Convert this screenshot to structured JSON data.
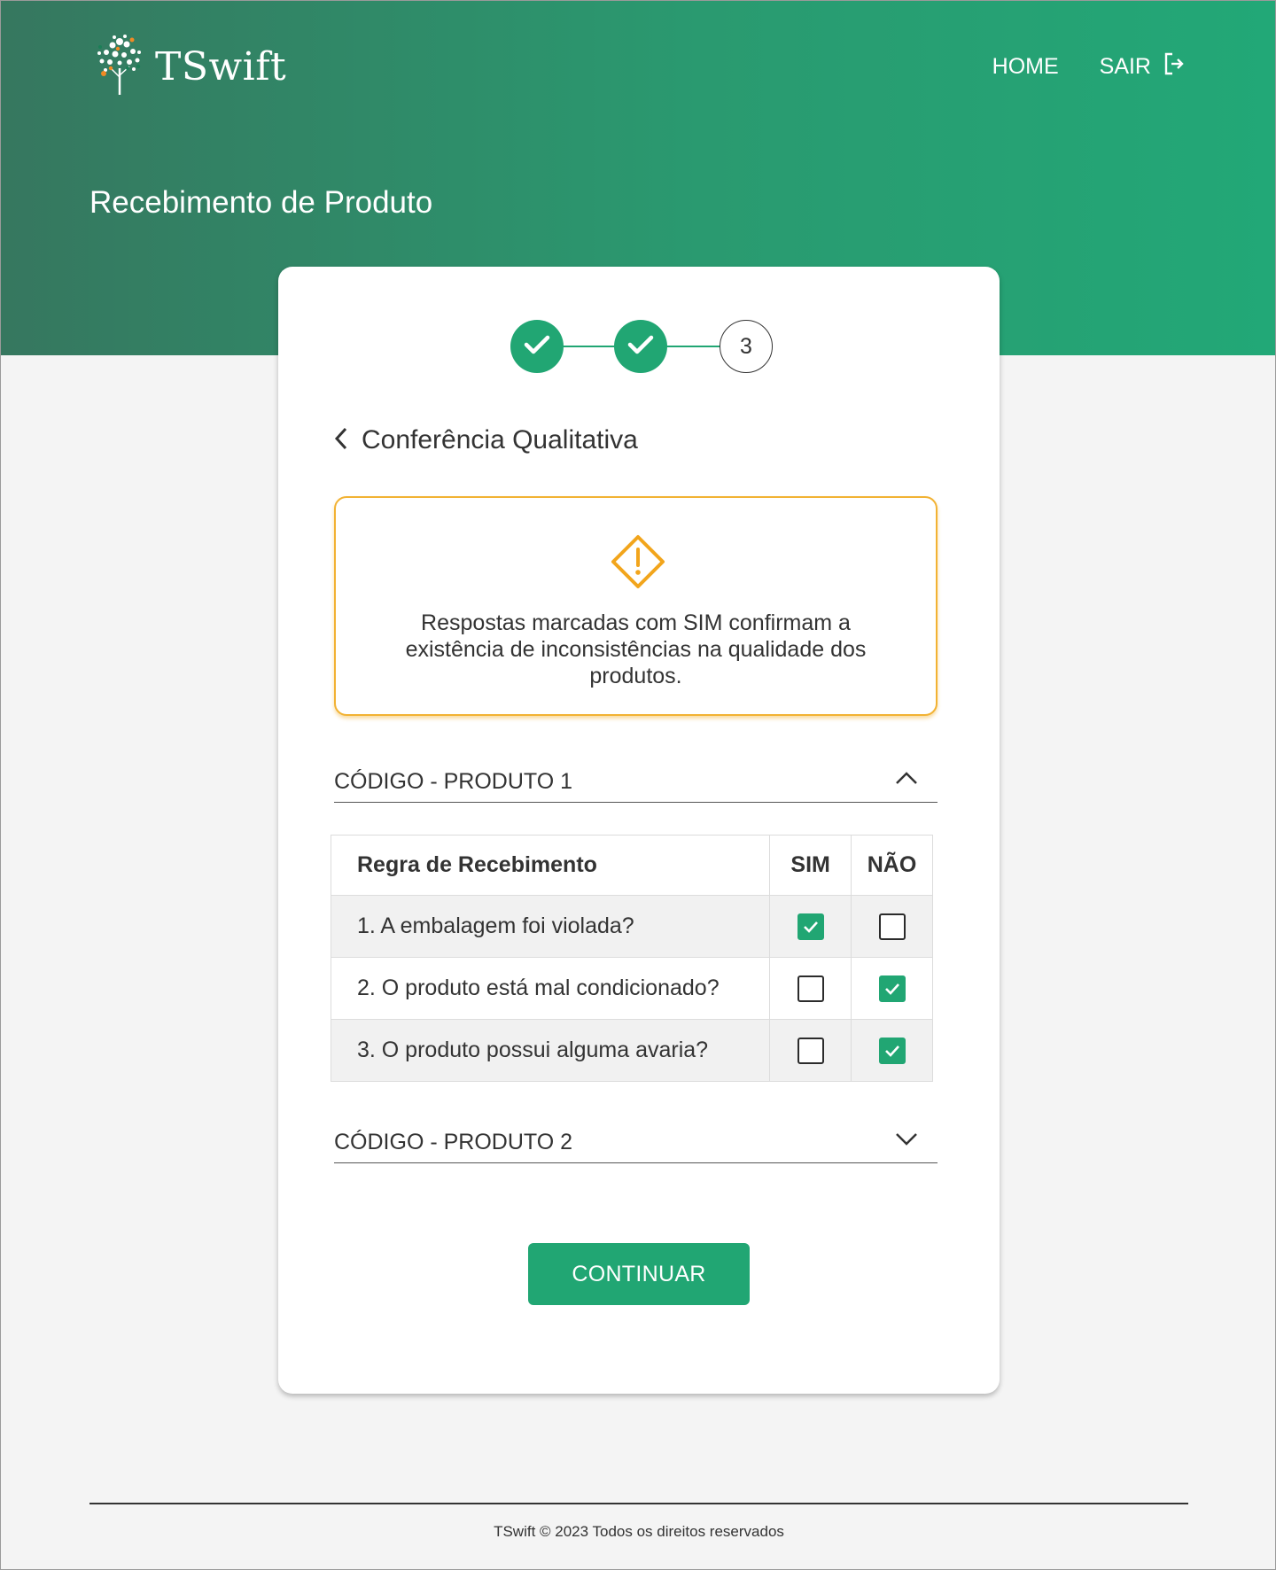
{
  "header": {
    "brand": "TSwift",
    "nav": {
      "home_label": "HOME",
      "logout_label": "SAIR"
    },
    "page_title": "Recebimento de Produto"
  },
  "stepper": {
    "steps": [
      {
        "state": "done"
      },
      {
        "state": "done"
      },
      {
        "state": "current",
        "label": "3"
      }
    ]
  },
  "section": {
    "title": "Conferência Qualitativa"
  },
  "alert": {
    "icon": "warning-diamond-icon",
    "message": "Respostas marcadas com SIM confirmam a existência de inconsistências na qualidade dos produtos."
  },
  "products": [
    {
      "label": "CÓDIGO - PRODUTO 1",
      "expanded": true,
      "table": {
        "headers": [
          "Regra de Recebimento",
          "SIM",
          "NÃO"
        ],
        "rows": [
          {
            "rule": "1. A embalagem foi violada?",
            "sim": true,
            "nao": false
          },
          {
            "rule": "2. O produto está mal condicionado?",
            "sim": false,
            "nao": true
          },
          {
            "rule": "3. O produto possui alguma avaria?",
            "sim": false,
            "nao": true
          }
        ]
      }
    },
    {
      "label": "CÓDIGO - PRODUTO 2",
      "expanded": false
    }
  ],
  "actions": {
    "continue_label": "CONTINUAR"
  },
  "footer": {
    "text": "TSwift © 2023 Todos os direitos reservados"
  },
  "colors": {
    "primary": "#21a673",
    "header_gradient_start": "#36775f",
    "header_gradient_end": "#22a877",
    "warning": "#f2b233",
    "background": "#f4f4f4"
  }
}
